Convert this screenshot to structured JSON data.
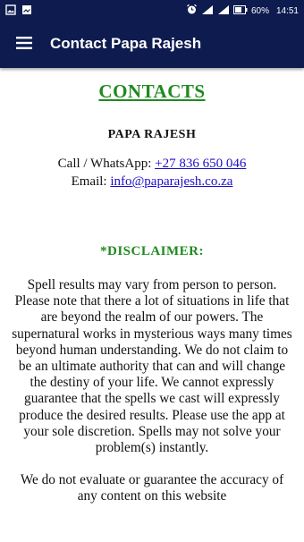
{
  "status_bar": {
    "battery": "60%",
    "time": "14:51"
  },
  "app_bar": {
    "title": "Contact Papa Rajesh"
  },
  "content": {
    "heading": "CONTACTS",
    "name": "PAPA RAJESH",
    "phone_label": "Call / WhatsApp: ",
    "phone": "+27 836 650 046",
    "email_label": "Email: ",
    "email": "info@paparajesh.co.za",
    "disclaimer_title": "*DISCLAIMER:",
    "disclaimer_text": "Spell results may vary from person to person. Please note that there a lot of situations in life that are beyond the realm of our powers. The supernatural works in mysterious ways many times beyond human understanding. We do not claim to be an ultimate authority that can and will change the destiny of your life. We cannot expressly guarantee that the spells we cast will expressly produce the desired results. Please use the app at your sole discretion. Spells may not solve your problem(s) instantly.",
    "second_paragraph": "We do not evaluate or guarantee the accuracy of any content on this website"
  },
  "colors": {
    "app_bar": "#0d1b4f",
    "accent_green": "#1f8a1f",
    "link_blue": "#1a0dcc"
  },
  "icons": [
    "photo-icon",
    "gallery-icon",
    "alarm-icon",
    "signal-icon",
    "battery-icon",
    "menu-icon"
  ]
}
